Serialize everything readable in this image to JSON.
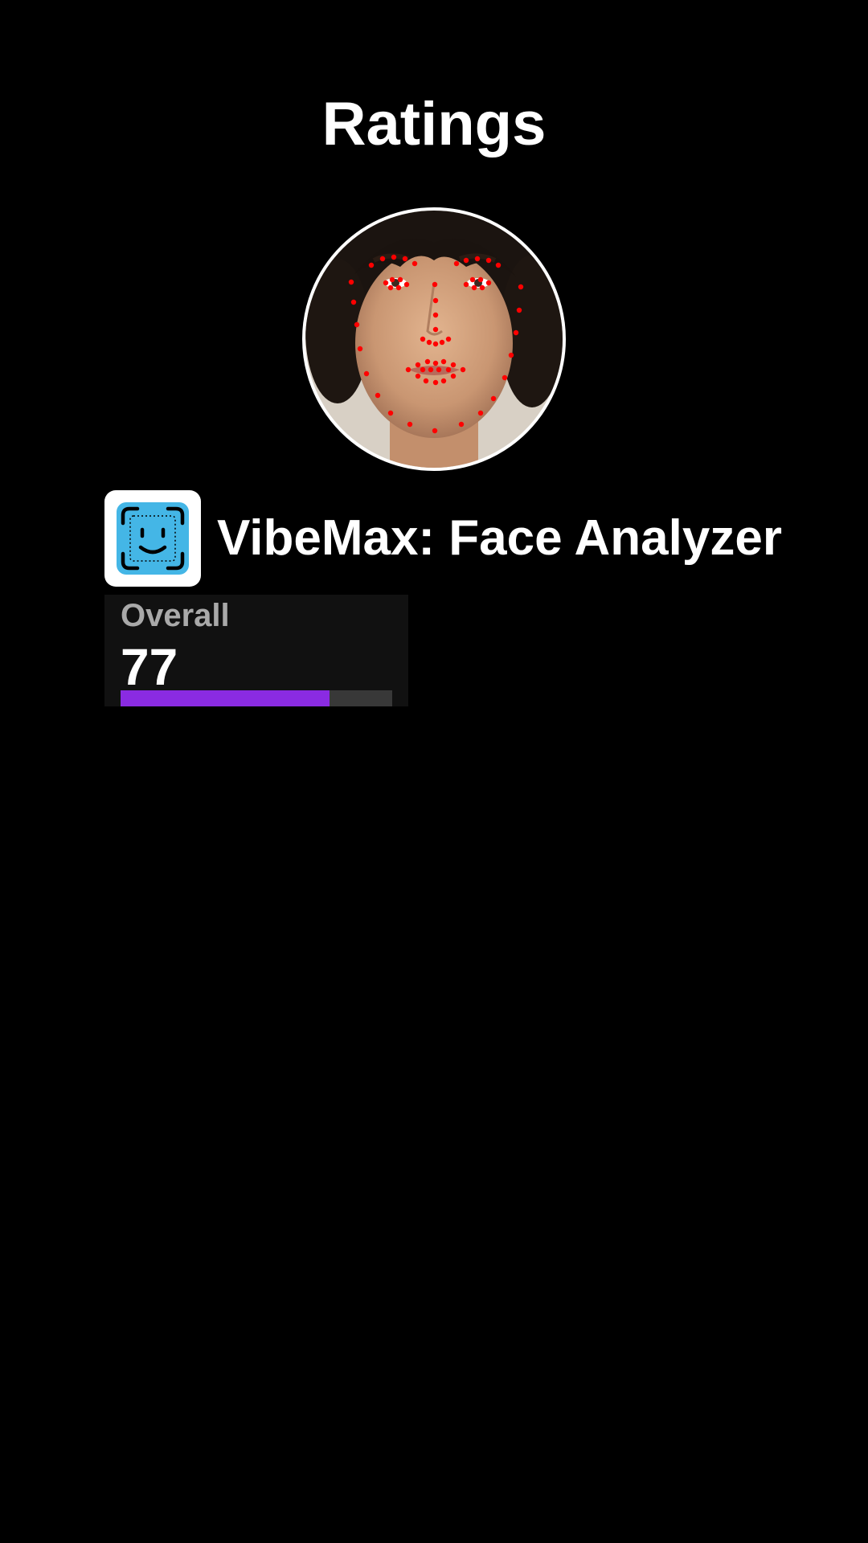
{
  "header": {
    "title": "Ratings"
  },
  "profile": {
    "photo_icon": "face-photo-with-landmarks",
    "landmark_color": "#ff0000"
  },
  "brand": {
    "icon": "face-id-smile-icon",
    "icon_color": "#44b6e6",
    "name": "VibeMax: Face Analyzer"
  },
  "scores": [
    {
      "label": "Overall",
      "value": "77",
      "progress": 0.77,
      "bar_color": "#8a2be2"
    }
  ]
}
